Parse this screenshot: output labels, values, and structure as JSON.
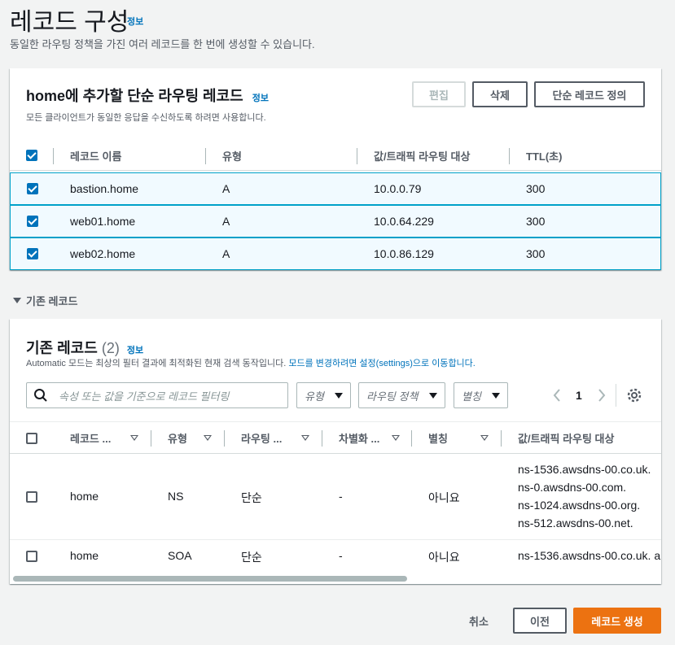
{
  "page": {
    "title": "레코드 구성",
    "info": "정보",
    "description": "동일한 라우팅 정책을 가진 여러 레코드를 한 번에 생성할 수 있습니다."
  },
  "new_records": {
    "title": "home에 추가할 단순 라우팅 레코드",
    "info": "정보",
    "description": "모든 클라이언트가 동일한 응답을 수신하도록 하려면 사용합니다.",
    "buttons": {
      "edit": "편집",
      "delete": "삭제",
      "define": "단순 레코드 정의"
    },
    "columns": [
      "레코드 이름",
      "유형",
      "값/트래픽 라우팅 대상",
      "TTL(초)"
    ],
    "rows": [
      {
        "name": "bastion.home",
        "type": "A",
        "value": "10.0.0.79",
        "ttl": "300",
        "checked": true
      },
      {
        "name": "web01.home",
        "type": "A",
        "value": "10.0.64.229",
        "ttl": "300",
        "checked": true
      },
      {
        "name": "web02.home",
        "type": "A",
        "value": "10.0.86.129",
        "ttl": "300",
        "checked": true
      }
    ]
  },
  "existing_toggle": "기존 레코드",
  "existing_records": {
    "title": "기존 레코드",
    "count": "(2)",
    "info": "정보",
    "description": "Automatic 모드는 최상의 필터 결과에 최적화된 현재 검색 동작입니다.",
    "description_link": "모드를 변경하려면 설정(settings)으로 이동합니다.",
    "filter_placeholder": "속성 또는 값을 기준으로 레코드 필터링",
    "selects": {
      "type": "유형",
      "routing": "라우팅 정책",
      "alias": "별칭"
    },
    "pagination": {
      "page": "1"
    },
    "columns": [
      "레코드 ...",
      "유형",
      "라우팅 ...",
      "차별화 ...",
      "별칭",
      "값/트래픽 라우팅 대상"
    ],
    "rows": [
      {
        "name": "home",
        "type": "NS",
        "routing": "단순",
        "diff": "-",
        "alias": "아니요",
        "values": [
          "ns-1536.awsdns-00.co.uk.",
          "ns-0.awsdns-00.com.",
          "ns-1024.awsdns-00.org.",
          "ns-512.awsdns-00.net."
        ]
      },
      {
        "name": "home",
        "type": "SOA",
        "routing": "단순",
        "diff": "-",
        "alias": "아니요",
        "values": [
          "ns-1536.awsdns-00.co.uk. a"
        ]
      }
    ]
  },
  "footer": {
    "cancel": "취소",
    "previous": "이전",
    "create": "레코드 생성"
  },
  "colors": {
    "accent": "#0073bb",
    "primary": "#ec7211",
    "selected_row": "#f1faff"
  }
}
